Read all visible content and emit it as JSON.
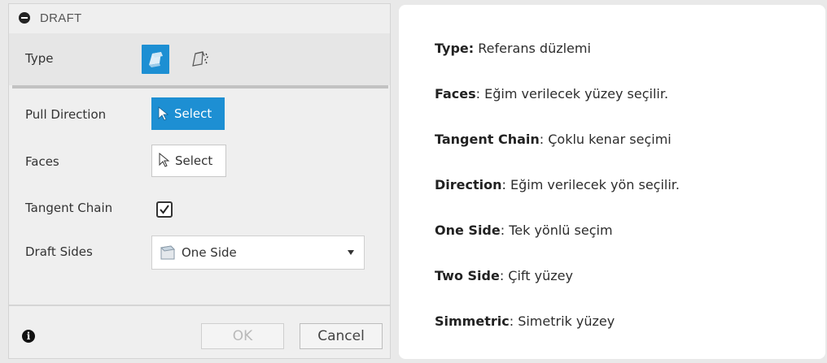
{
  "dialog": {
    "title": "DRAFT",
    "type_label": "Type",
    "pull_direction_label": "Pull Direction",
    "pull_direction_button": "Select",
    "faces_label": "Faces",
    "faces_button": "Select",
    "tangent_chain_label": "Tangent Chain",
    "tangent_chain_checked": true,
    "draft_sides_label": "Draft Sides",
    "draft_sides_value": "One Side",
    "ok_label": "OK",
    "cancel_label": "Cancel",
    "accent_color": "#1d8fd3"
  },
  "descriptions": [
    {
      "term": "Type:",
      "text": " Referans düzlemi"
    },
    {
      "term": "Faces",
      "text": ": Eğim verilecek yüzey seçilir."
    },
    {
      "term": "Tangent Chain",
      "text": ": Çoklu kenar seçimi"
    },
    {
      "term": "Direction",
      "text": ": Eğim verilecek yön seçilir."
    },
    {
      "term": "One Side",
      "text": ": Tek yönlü seçim"
    },
    {
      "term": "Two Side",
      "text": ": Çift yüzey"
    },
    {
      "term": "Simmetric",
      "text": ": Simetrik yüzey"
    }
  ]
}
